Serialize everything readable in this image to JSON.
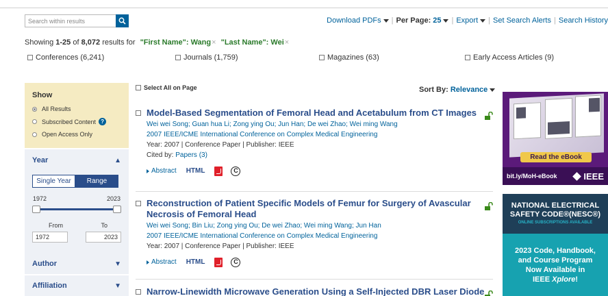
{
  "search": {
    "placeholder": "Search within results"
  },
  "toolbar": {
    "download_label": "Download PDFs",
    "per_page_label": "Per Page:",
    "per_page_value": "25",
    "export_label": "Export",
    "alerts_label": "Set Search Alerts",
    "history_label": "Search History"
  },
  "summary": {
    "prefix": "Showing",
    "range": "1-25",
    "of": "of",
    "total": "8,072",
    "suffix": "results for",
    "filters": [
      "\"First Name\": Wang",
      "\"Last Name\": Wei"
    ],
    "remove_glyph": "×"
  },
  "content_types": [
    {
      "label": "Conferences (6,241)"
    },
    {
      "label": "Journals (1,759)"
    },
    {
      "label": "Magazines (63)"
    },
    {
      "label": "Early Access Articles (9)"
    }
  ],
  "sidebar": {
    "show_title": "Show",
    "show_options": [
      "All Results",
      "Subscribed Content",
      "Open Access Only"
    ],
    "year_title": "Year",
    "year_tabs": [
      "Single Year",
      "Range"
    ],
    "year_min": "1972",
    "year_max": "2023",
    "from_label": "From",
    "to_label": "To",
    "from_value": "1972",
    "to_value": "2023",
    "author_title": "Author",
    "affiliation_title": "Affiliation"
  },
  "results_header": {
    "select_all": "Select All on Page",
    "sort_label": "Sort By:",
    "sort_value": "Relevance"
  },
  "results": [
    {
      "title": "Model-Based Segmentation of Femoral Head and Acetabulum from CT Images",
      "authors": "Wei wei Song; Guan hua Li; Zong ying Ou; Jun Han; De wei Zhao; Wei ming Wang",
      "conference": "2007 IEEE/ICME International Conference on Complex Medical Engineering",
      "meta": "Year: 2007  |  Conference Paper  |  Publisher: IEEE",
      "cited_prefix": "Cited by:",
      "cited_link": "Papers (3)",
      "abstract": "Abstract",
      "html": "HTML"
    },
    {
      "title": "Reconstruction of Patient Specific Models of Femur for Surgery of Avascular Necrosis of Femoral Head",
      "authors": "Wei wei Song; Bin Liu; Zong ying Ou; De wei Zhao; Wei ming Wang; Jun Han",
      "conference": "2007 IEEE/ICME International Conference on Complex Medical Engineering",
      "meta": "Year: 2007  |  Conference Paper  |  Publisher: IEEE",
      "abstract": "Abstract",
      "html": "HTML"
    },
    {
      "title": "Narrow-Linewidth Microwave Generation Using a Self-Injected DBR Laser Diode"
    }
  ],
  "ads": {
    "ebook_button": "Read the eBook",
    "ebook_url": "bit.ly/MoH-eBook",
    "ieee_logo": "IEEE",
    "nesc_title_1": "NATIONAL ELECTRICAL",
    "nesc_title_2": "SAFETY CODE®(NESC®)",
    "nesc_sub": "ONLINE SUBSCRIPTIONS AVAILABLE",
    "nesc_line1": "2023 Code, Handbook,",
    "nesc_line2": "and Course Program",
    "nesc_line3": "Now Available in",
    "nesc_line4_a": "IEEE ",
    "nesc_line4_b": "Xplore",
    "nesc_line4_c": "!"
  },
  "colors": {
    "link_blue": "#00629b",
    "title_blue": "#2a4d8a",
    "filter_green": "#2a7a2a",
    "show_bg": "#f5ebc2",
    "facet_bg": "#eef1f6",
    "pdf_red": "#e0202a",
    "ad_purple": "#5b1a7a",
    "ad_teal": "#17a2b0"
  },
  "icons": [
    "search-icon",
    "caret-down-icon",
    "question-icon",
    "chevron-up-icon",
    "chevron-down-icon",
    "open-lock-icon",
    "pdf-icon",
    "copyright-icon"
  ]
}
